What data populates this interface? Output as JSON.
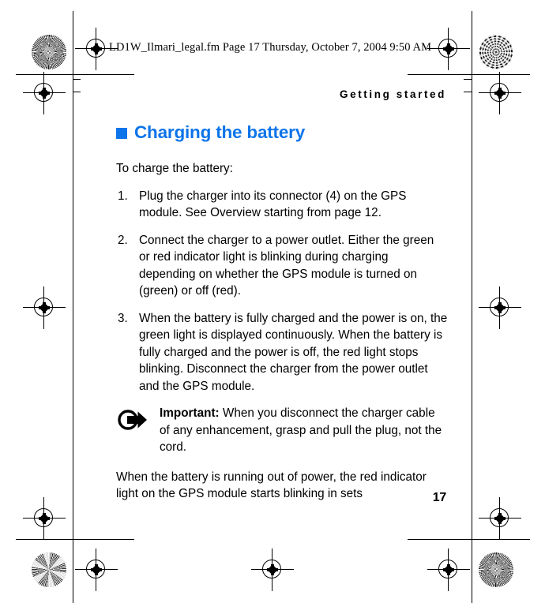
{
  "proof": {
    "header_stamp": "LD1W_Ilmari_legal.fm  Page 17  Thursday, October 7, 2004  9:50 AM",
    "marks": {
      "registration_icon": "registration-target-icon",
      "halftone_icon": "halftone-swatch-icon"
    }
  },
  "page": {
    "running_head": "Getting started",
    "page_number": "17",
    "heading": {
      "bullet_icon": "square-bullet-icon",
      "text": "Charging the battery",
      "color": "#0d74ea"
    },
    "intro": "To charge the battery:",
    "steps": [
      "Plug the charger into its connector (4) on the GPS module. See Overview starting from page 12.",
      "Connect the charger to a power outlet. Either the green or red indicator light is blinking during charging depending on whether the GPS module is turned on (green) or off (red).",
      "When the battery is fully charged and the power is on, the green light is displayed continuously. When the battery is fully charged and the power is off, the red light stops blinking. Disconnect the charger from the power outlet and the GPS module."
    ],
    "note": {
      "icon": "note-arrow-icon",
      "label": "Important:",
      "text": " When you disconnect the charger cable of any enhancement, grasp and pull the plug, not the cord."
    },
    "closing": "When the battery is running out of power, the red indicator light on the GPS module starts blinking in sets"
  }
}
